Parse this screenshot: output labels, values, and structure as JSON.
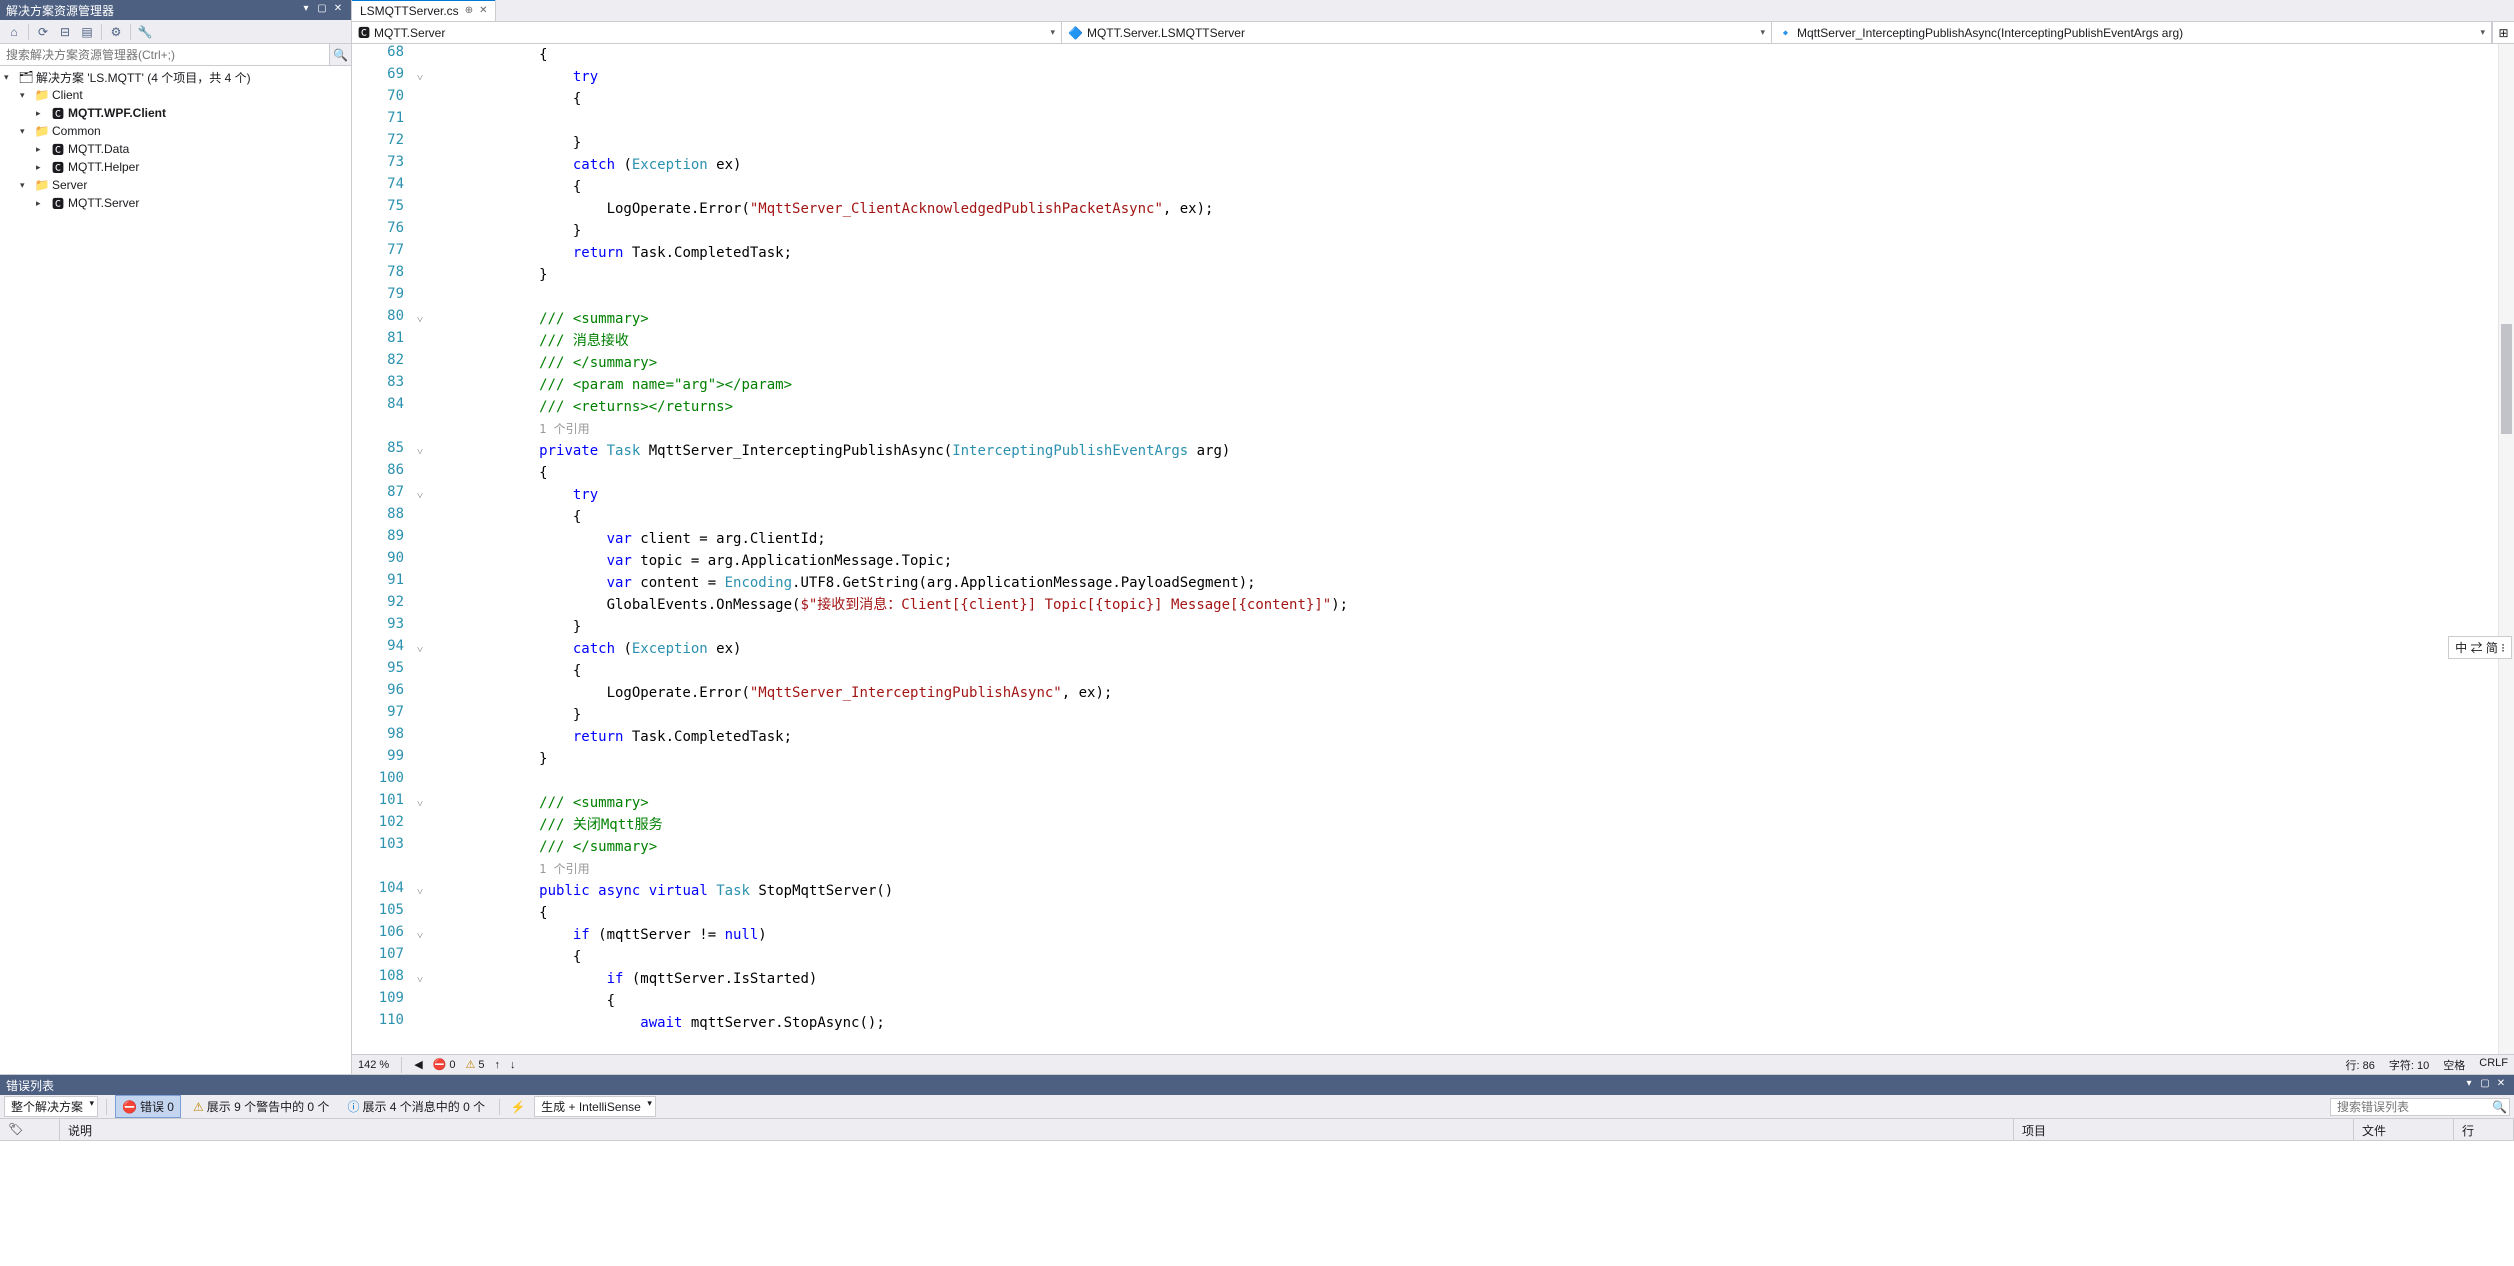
{
  "solutionExplorer": {
    "title": "解决方案资源管理器",
    "searchPlaceholder": "搜索解决方案资源管理器(Ctrl+;)",
    "tree": [
      {
        "indent": 0,
        "exp": "▾",
        "icon": "🗂",
        "label": "解决方案 'LS.MQTT' (4 个项目，共 4 个)",
        "bold": false
      },
      {
        "indent": 1,
        "exp": "▾",
        "icon": "📁",
        "label": "Client",
        "bold": false
      },
      {
        "indent": 2,
        "exp": "▸",
        "icon": "🅲",
        "label": "MQTT.WPF.Client",
        "bold": true
      },
      {
        "indent": 1,
        "exp": "▾",
        "icon": "📁",
        "label": "Common",
        "bold": false
      },
      {
        "indent": 2,
        "exp": "▸",
        "icon": "🅲",
        "label": "MQTT.Data",
        "bold": false
      },
      {
        "indent": 2,
        "exp": "▸",
        "icon": "🅲",
        "label": "MQTT.Helper",
        "bold": false
      },
      {
        "indent": 1,
        "exp": "▾",
        "icon": "📁",
        "label": "Server",
        "bold": false
      },
      {
        "indent": 2,
        "exp": "▸",
        "icon": "🅲",
        "label": "MQTT.Server",
        "bold": false
      }
    ]
  },
  "editor": {
    "tab": {
      "name": "LSMQTTServer.cs"
    },
    "nav": {
      "left": "MQTT.Server",
      "middle": "MQTT.Server.LSMQTTServer",
      "right": "MqttServer_InterceptingPublishAsync(InterceptingPublishEventArgs arg)"
    },
    "startLine": 68,
    "lines": [
      {
        "indent": 3,
        "tokens": [
          {
            "t": "{",
            "c": "ident"
          }
        ]
      },
      {
        "indent": 4,
        "tokens": [
          {
            "t": "try",
            "c": "kw"
          }
        ]
      },
      {
        "indent": 4,
        "tokens": [
          {
            "t": "{",
            "c": "ident"
          }
        ]
      },
      {
        "indent": 4,
        "tokens": []
      },
      {
        "indent": 4,
        "tokens": [
          {
            "t": "}",
            "c": "ident"
          }
        ]
      },
      {
        "indent": 4,
        "tokens": [
          {
            "t": "catch",
            "c": "kw"
          },
          {
            "t": " (",
            "c": "ident"
          },
          {
            "t": "Exception",
            "c": "type"
          },
          {
            "t": " ex)",
            "c": "ident"
          }
        ]
      },
      {
        "indent": 4,
        "tokens": [
          {
            "t": "{",
            "c": "ident"
          }
        ]
      },
      {
        "indent": 5,
        "tokens": [
          {
            "t": "LogOperate.Error(",
            "c": "ident"
          },
          {
            "t": "\"MqttServer_ClientAcknowledgedPublishPacketAsync\"",
            "c": "str"
          },
          {
            "t": ", ex);",
            "c": "ident"
          }
        ]
      },
      {
        "indent": 4,
        "tokens": [
          {
            "t": "}",
            "c": "ident"
          }
        ]
      },
      {
        "indent": 4,
        "tokens": [
          {
            "t": "return",
            "c": "kw"
          },
          {
            "t": " Task.CompletedTask;",
            "c": "ident"
          }
        ]
      },
      {
        "indent": 3,
        "tokens": [
          {
            "t": "}",
            "c": "ident"
          }
        ]
      },
      {
        "indent": 0,
        "tokens": []
      },
      {
        "indent": 3,
        "tokens": [
          {
            "t": "/// <summary>",
            "c": "comment"
          }
        ]
      },
      {
        "indent": 3,
        "tokens": [
          {
            "t": "/// 消息接收",
            "c": "comment"
          }
        ]
      },
      {
        "indent": 3,
        "tokens": [
          {
            "t": "/// </summary>",
            "c": "comment"
          }
        ]
      },
      {
        "indent": 3,
        "tokens": [
          {
            "t": "/// <param name=",
            "c": "comment"
          },
          {
            "t": "\"arg\"",
            "c": "comment"
          },
          {
            "t": "></param>",
            "c": "comment"
          }
        ]
      },
      {
        "indent": 3,
        "tokens": [
          {
            "t": "/// <returns></returns>",
            "c": "comment"
          }
        ]
      },
      {
        "indent": 3,
        "tokens": [
          {
            "t": "1 个引用",
            "c": "codelens"
          }
        ],
        "codelens": true
      },
      {
        "indent": 3,
        "tokens": [
          {
            "t": "private",
            "c": "kw"
          },
          {
            "t": " ",
            "c": "ident"
          },
          {
            "t": "Task",
            "c": "type"
          },
          {
            "t": " MqttServer_InterceptingPublishAsync(",
            "c": "ident"
          },
          {
            "t": "InterceptingPublishEventArgs",
            "c": "type"
          },
          {
            "t": " arg)",
            "c": "ident"
          }
        ]
      },
      {
        "indent": 3,
        "tokens": [
          {
            "t": "{",
            "c": "ident"
          }
        ]
      },
      {
        "indent": 4,
        "tokens": [
          {
            "t": "try",
            "c": "kw"
          }
        ]
      },
      {
        "indent": 4,
        "tokens": [
          {
            "t": "{",
            "c": "ident"
          }
        ]
      },
      {
        "indent": 5,
        "tokens": [
          {
            "t": "var",
            "c": "kw"
          },
          {
            "t": " client = arg.ClientId;",
            "c": "ident"
          }
        ]
      },
      {
        "indent": 5,
        "tokens": [
          {
            "t": "var",
            "c": "kw"
          },
          {
            "t": " topic = arg.ApplicationMessage.Topic;",
            "c": "ident"
          }
        ]
      },
      {
        "indent": 5,
        "tokens": [
          {
            "t": "var",
            "c": "kw"
          },
          {
            "t": " content = ",
            "c": "ident"
          },
          {
            "t": "Encoding",
            "c": "type"
          },
          {
            "t": ".UTF8.GetString(arg.ApplicationMessage.PayloadSegment);",
            "c": "ident"
          }
        ]
      },
      {
        "indent": 5,
        "tokens": [
          {
            "t": "GlobalEvents.OnMessage(",
            "c": "ident"
          },
          {
            "t": "$\"接收到消息：Client[{client}] Topic[{topic}] Message[{content}]\"",
            "c": "str"
          },
          {
            "t": ");",
            "c": "ident"
          }
        ]
      },
      {
        "indent": 4,
        "tokens": [
          {
            "t": "}",
            "c": "ident"
          }
        ]
      },
      {
        "indent": 4,
        "tokens": [
          {
            "t": "catch",
            "c": "kw"
          },
          {
            "t": " (",
            "c": "ident"
          },
          {
            "t": "Exception",
            "c": "type"
          },
          {
            "t": " ex)",
            "c": "ident"
          }
        ]
      },
      {
        "indent": 4,
        "tokens": [
          {
            "t": "{",
            "c": "ident"
          }
        ]
      },
      {
        "indent": 5,
        "tokens": [
          {
            "t": "LogOperate.Error(",
            "c": "ident"
          },
          {
            "t": "\"MqttServer_InterceptingPublishAsync\"",
            "c": "str"
          },
          {
            "t": ", ex);",
            "c": "ident"
          }
        ]
      },
      {
        "indent": 4,
        "tokens": [
          {
            "t": "}",
            "c": "ident"
          }
        ]
      },
      {
        "indent": 4,
        "tokens": [
          {
            "t": "return",
            "c": "kw"
          },
          {
            "t": " Task.CompletedTask;",
            "c": "ident"
          }
        ]
      },
      {
        "indent": 3,
        "tokens": [
          {
            "t": "}",
            "c": "ident"
          }
        ]
      },
      {
        "indent": 0,
        "tokens": []
      },
      {
        "indent": 3,
        "tokens": [
          {
            "t": "/// <summary>",
            "c": "comment"
          }
        ]
      },
      {
        "indent": 3,
        "tokens": [
          {
            "t": "/// 关闭Mqtt服务",
            "c": "comment"
          }
        ]
      },
      {
        "indent": 3,
        "tokens": [
          {
            "t": "/// </summary>",
            "c": "comment"
          }
        ]
      },
      {
        "indent": 3,
        "tokens": [
          {
            "t": "1 个引用",
            "c": "codelens"
          }
        ],
        "codelens": true
      },
      {
        "indent": 3,
        "tokens": [
          {
            "t": "public",
            "c": "kw"
          },
          {
            "t": " ",
            "c": "ident"
          },
          {
            "t": "async",
            "c": "kw"
          },
          {
            "t": " ",
            "c": "ident"
          },
          {
            "t": "virtual",
            "c": "kw"
          },
          {
            "t": " ",
            "c": "ident"
          },
          {
            "t": "Task",
            "c": "type"
          },
          {
            "t": " StopMqttServer()",
            "c": "ident"
          }
        ]
      },
      {
        "indent": 3,
        "tokens": [
          {
            "t": "{",
            "c": "ident"
          }
        ]
      },
      {
        "indent": 4,
        "tokens": [
          {
            "t": "if",
            "c": "kw"
          },
          {
            "t": " (mqttServer != ",
            "c": "ident"
          },
          {
            "t": "null",
            "c": "kw"
          },
          {
            "t": ")",
            "c": "ident"
          }
        ]
      },
      {
        "indent": 4,
        "tokens": [
          {
            "t": "{",
            "c": "ident"
          }
        ]
      },
      {
        "indent": 5,
        "tokens": [
          {
            "t": "if",
            "c": "kw"
          },
          {
            "t": " (mqttServer.IsStarted)",
            "c": "ident"
          }
        ]
      },
      {
        "indent": 5,
        "tokens": [
          {
            "t": "{",
            "c": "ident"
          }
        ]
      },
      {
        "indent": 6,
        "tokens": [
          {
            "t": "await",
            "c": "kw"
          },
          {
            "t": " mqttServer.StopAsync();",
            "c": "ident"
          }
        ]
      }
    ],
    "foldMarks": {
      "69": "v",
      "80": "v",
      "85": "v",
      "87": "v",
      "94": "v",
      "101": "v",
      "104": "v",
      "106": "v",
      "108": "v"
    }
  },
  "statusStrip": {
    "zoom": "142 %",
    "errors": "0",
    "warnings": "5",
    "line": "行: 86",
    "col": "字符: 10",
    "spaces": "空格",
    "crlf": "CRLF"
  },
  "errorList": {
    "title": "错误列表",
    "scope": "整个解决方案",
    "errorFilter": "错误 0",
    "warningFilter": "展示 9 个警告中的 0 个",
    "messageFilter": "展示 4 个消息中的 0 个",
    "buildFilter": "生成 + IntelliSense",
    "searchPlaceholder": "搜索错误列表",
    "columns": {
      "desc": "说明",
      "proj": "项目",
      "file": "文件",
      "line": "行"
    }
  },
  "imeBadge": "中 ⇄ 简 ⁝"
}
